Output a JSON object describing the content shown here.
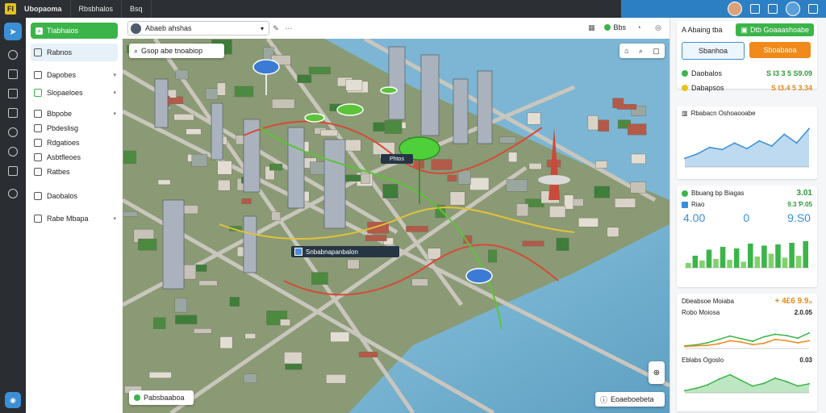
{
  "topbar": {
    "logo": "FI",
    "brand": "Ubopaoma",
    "menu1": "Rbsbhalos",
    "menu2": "Bsq"
  },
  "sidebar": {
    "new_button": "Tlabhaios",
    "items": [
      {
        "label": "Rabnos"
      },
      {
        "label": "Dapobes"
      },
      {
        "label": "Slopaeloes"
      },
      {
        "label": "Bbpobe"
      },
      {
        "label": "Pbdeslisg"
      },
      {
        "label": "Rdgatioes"
      },
      {
        "label": "Asbtfleoes"
      },
      {
        "label": "Ratbes"
      },
      {
        "label": "Daobalos"
      },
      {
        "label": "Rabe Mbapa"
      }
    ]
  },
  "toolbar": {
    "project_name": "Abaeb ahshas",
    "status_label": "Bbs"
  },
  "map": {
    "search_text": "Gsop  abe  tnoabiop",
    "tooltip_text": "Snbabnapanbalon",
    "tag_text": "Phtos",
    "legend_text": "Pabsbaaboa",
    "scale_text": "Eoaeboebeta",
    "colors": {
      "water": "#6aa8c9",
      "land": "#8a9a74",
      "route_green": "#5cc33a",
      "route_red": "#d64a3a"
    }
  },
  "panel": {
    "header_title": "A Abaing tba",
    "header_badge": "Dtb Goaaashoabe",
    "btn_secondary": "Sbanhoa",
    "btn_primary": "Sboabaoa",
    "kpis": [
      {
        "label": "Daobalos",
        "value": "S Ɩ3 3 5 S9.09",
        "color": "#3bb54a"
      },
      {
        "label": "Dabapsos",
        "value": "S Ɩ3.4 5 3.34",
        "color": "#e4c31c"
      }
    ],
    "chart1": {
      "title": "Rbabacn Oshoaooabe"
    },
    "chart2": {
      "title": "Bbuang bp Biagas",
      "value": "3.01",
      "sub_label": "Riao",
      "sub_value": "9.3 Ƥ.05",
      "big_left": "4.00",
      "big_mid": "0",
      "big_right": "9.S0"
    },
    "chart3": {
      "title": "Dbeabsoe Moiaba",
      "value": "+ 4£6  9.9₀",
      "sub_label": "Robo Moiosa",
      "sub_value": "2.0.05"
    },
    "chart4": {
      "title": "Eblabs Ogoslo",
      "sub_value": "0.03"
    }
  },
  "chart_data": [
    {
      "type": "area",
      "series": [
        {
          "values": [
            20,
            30,
            45,
            40,
            55,
            42,
            60,
            48,
            75,
            55,
            88
          ]
        }
      ],
      "ylim": [
        0,
        100
      ]
    },
    {
      "type": "bar",
      "series": [
        {
          "values": [
            12,
            30,
            18,
            45,
            22,
            52,
            20,
            48,
            15,
            60,
            28,
            55,
            35,
            58,
            25,
            62,
            30,
            66
          ]
        }
      ],
      "ylim": [
        0,
        100
      ]
    },
    {
      "type": "line",
      "series": [
        {
          "values": [
            10,
            14,
            22,
            35,
            48,
            38,
            28,
            45,
            55,
            50,
            40,
            60
          ]
        },
        {
          "values": [
            8,
            10,
            12,
            18,
            30,
            25,
            15,
            20,
            35,
            30,
            22,
            30
          ]
        }
      ],
      "ylim": [
        0,
        100
      ]
    },
    {
      "type": "area",
      "series": [
        {
          "values": [
            10,
            20,
            35,
            60,
            80,
            55,
            30,
            42,
            65,
            50,
            30,
            40
          ]
        }
      ],
      "ylim": [
        0,
        100
      ]
    }
  ]
}
